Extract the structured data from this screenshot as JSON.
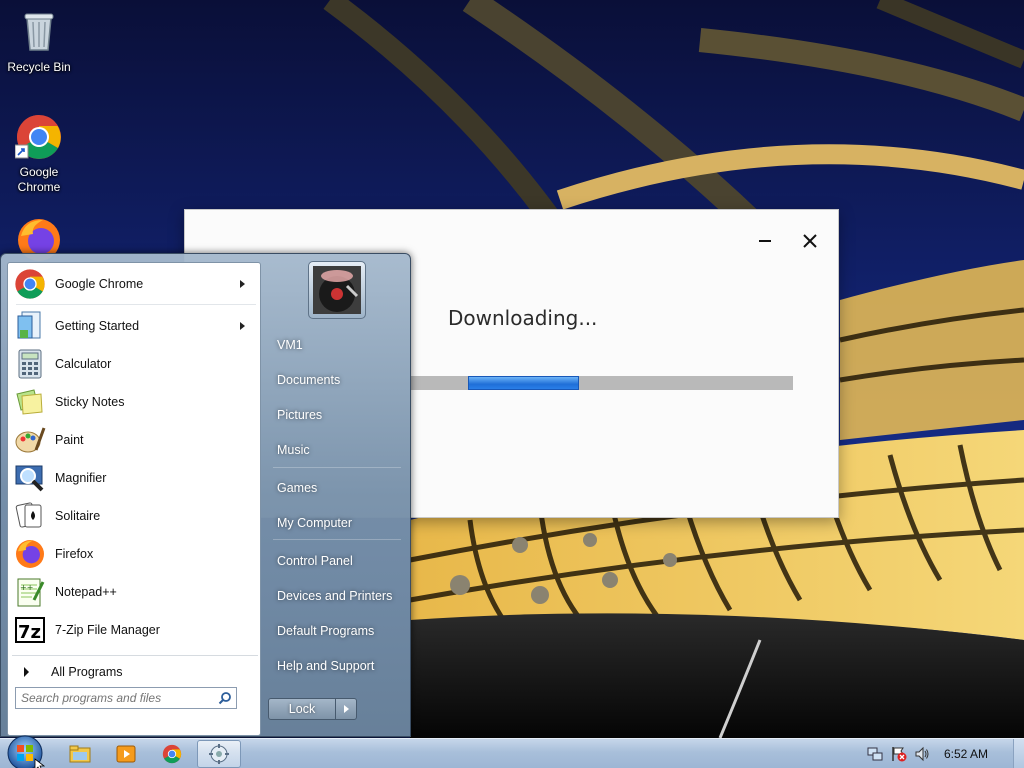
{
  "desktop": {
    "icons": [
      {
        "label": "Recycle Bin",
        "icon": "recycle-bin-icon"
      },
      {
        "label": "Google Chrome",
        "icon": "chrome-icon"
      },
      {
        "label": "",
        "icon": "firefox-icon"
      }
    ]
  },
  "dialog": {
    "title": "Downloading...",
    "progress": 0.29,
    "progress_offset": 0.15,
    "progress_color": "#2a7fe8"
  },
  "start_menu": {
    "programs": [
      {
        "label": "Google Chrome",
        "icon": "chrome-icon",
        "submenu": true
      },
      {
        "label": "Getting Started",
        "icon": "getting-started-icon",
        "submenu": true
      },
      {
        "label": "Calculator",
        "icon": "calculator-icon",
        "submenu": false
      },
      {
        "label": "Sticky Notes",
        "icon": "sticky-notes-icon",
        "submenu": false
      },
      {
        "label": "Paint",
        "icon": "paint-icon",
        "submenu": false
      },
      {
        "label": "Magnifier",
        "icon": "magnifier-icon",
        "submenu": false
      },
      {
        "label": "Solitaire",
        "icon": "solitaire-icon",
        "submenu": false
      },
      {
        "label": "Firefox",
        "icon": "firefox-icon",
        "submenu": false
      },
      {
        "label": "Notepad++",
        "icon": "notepadpp-icon",
        "submenu": false
      },
      {
        "label": "7-Zip File Manager",
        "icon": "7zip-icon",
        "submenu": false
      }
    ],
    "all_programs": "All Programs",
    "search_placeholder": "Search programs and files",
    "right_items": [
      "VM1",
      "Documents",
      "Pictures",
      "Music",
      "Games",
      "My Computer",
      "Control Panel",
      "Devices and Printers",
      "Default Programs",
      "Help and Support"
    ],
    "lock_label": "Lock"
  },
  "taskbar": {
    "clock": "6:52 AM",
    "pinned": [
      "explorer-icon",
      "media-player-icon",
      "chrome-icon",
      "installer-icon"
    ],
    "tray": [
      "network-icon",
      "action-center-icon",
      "volume-icon"
    ]
  }
}
